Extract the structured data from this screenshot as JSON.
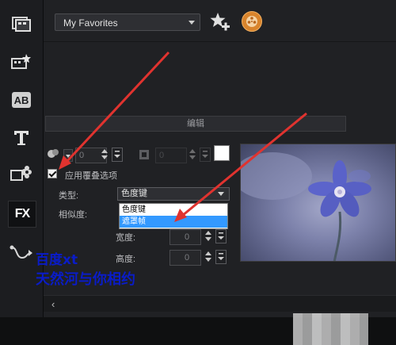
{
  "sidebar": {
    "items": [
      {
        "name": "media-icon"
      },
      {
        "name": "instant-project-icon"
      },
      {
        "name": "title-ab-icon"
      },
      {
        "name": "text-t-icon"
      },
      {
        "name": "graphics-icon"
      },
      {
        "name": "fx-icon",
        "label": "FX",
        "active": true
      },
      {
        "name": "path-icon"
      }
    ]
  },
  "library": {
    "dropdown_value": "My Favorites",
    "add_favorite_icon": "star-add-icon",
    "film_icon": "film-reel-icon"
  },
  "panel": {
    "edit_tab": "编辑",
    "spinner1_value": "0",
    "spinner2_value": "0",
    "overlay_checkbox_label": "应用覆叠选项",
    "overlay_checked": true,
    "type_label": "类型:",
    "type_value": "色度键",
    "similarity_label": "相似度:",
    "width_label": "宽度:",
    "height_label": "高度:",
    "width_value": "0",
    "height_value": "0",
    "dropdown_options": [
      "色度键",
      "遮罩帧"
    ],
    "dropdown_selected": "遮罩帧",
    "swatch_color": "#ffffff"
  },
  "watermark": {
    "line1": "百度xt",
    "line2": "天然河与你相约"
  },
  "colors": {
    "accent_arrow": "#e0332f",
    "selection": "#3399ff"
  }
}
